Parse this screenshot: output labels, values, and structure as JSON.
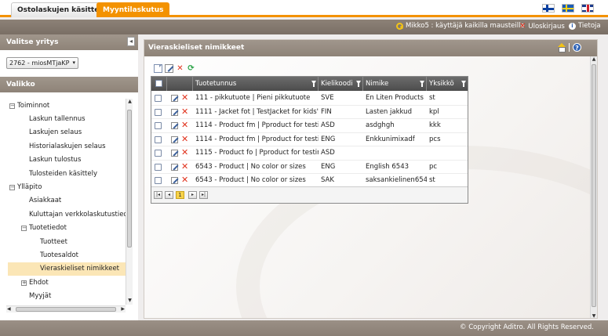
{
  "tabs": [
    {
      "label": "Ostolaskujen käsittely",
      "active": false
    },
    {
      "label": "Myyntilaskutus",
      "active": true
    }
  ],
  "languages": [
    "fi",
    "sv",
    "en"
  ],
  "userbar": {
    "user": "Mikko5 : käyttäjä kaikilla mausteilla",
    "logout": "Uloskirjaus",
    "info": "Tietoja"
  },
  "company": {
    "title": "Valitse yritys",
    "selected": "2762 - miosMTjaKP"
  },
  "menu": {
    "title": "Valikko",
    "items": [
      {
        "label": "Toiminnot",
        "level": 0,
        "toggle": "−"
      },
      {
        "label": "Laskun tallennus",
        "level": 1
      },
      {
        "label": "Laskujen selaus",
        "level": 1
      },
      {
        "label": "Historialaskujen selaus",
        "level": 1
      },
      {
        "label": "Laskun tulostus",
        "level": 1
      },
      {
        "label": "Tulosteiden käsittely",
        "level": 1
      },
      {
        "label": "Ylläpito",
        "level": 0,
        "toggle": "−"
      },
      {
        "label": "Asiakkaat",
        "level": 1
      },
      {
        "label": "Kuluttajan verkkolaskutustiedot",
        "level": 1
      },
      {
        "label": "Tuotetiedot",
        "level": 1,
        "toggle": "−"
      },
      {
        "label": "Tuotteet",
        "level": 2
      },
      {
        "label": "Tuotesaldot",
        "level": 2
      },
      {
        "label": "Vieraskieliset nimikkeet",
        "level": 2,
        "selected": true
      },
      {
        "label": "Ehdot",
        "level": 1,
        "toggle": "+"
      },
      {
        "label": "Myyjät",
        "level": 1
      }
    ]
  },
  "main": {
    "title": "Vieraskieliset nimikkeet",
    "columns": [
      "Tuotetunnus",
      "Kielikoodi",
      "Nimike",
      "Yksikkö"
    ],
    "rows": [
      {
        "product": "111 - pikkutuote | Pieni pikkutuote",
        "lang": "SVE",
        "name": "En Liten Products",
        "unit": "st"
      },
      {
        "product": "1111 - Jacket fot | TestJacket for kids's",
        "lang": "FIN",
        "name": "Lasten jakkud",
        "unit": "kpl"
      },
      {
        "product": "1114 - Product fm | Pproduct for testing",
        "lang": "ASD",
        "name": "asdghgh",
        "unit": "kkk"
      },
      {
        "product": "1114 - Product fm | Pproduct for testing",
        "lang": "ENG",
        "name": "Enkkunimixadf",
        "unit": "pcs"
      },
      {
        "product": "1115 - Product fo | Pproduct for testing",
        "lang": "ASD",
        "name": "",
        "unit": ""
      },
      {
        "product": "6543 - Product | No color or sizes",
        "lang": "ENG",
        "name": "English 6543",
        "unit": "pc"
      },
      {
        "product": "6543 - Product | No color or sizes",
        "lang": "SAK",
        "name": "saksankielinen6543",
        "unit": "st"
      }
    ],
    "pager": {
      "first": "|◂",
      "prev": "◂",
      "current": "1",
      "next": "▸",
      "last": "▸|"
    }
  },
  "footer": "© Copyright Aditro. All Rights Reserved."
}
